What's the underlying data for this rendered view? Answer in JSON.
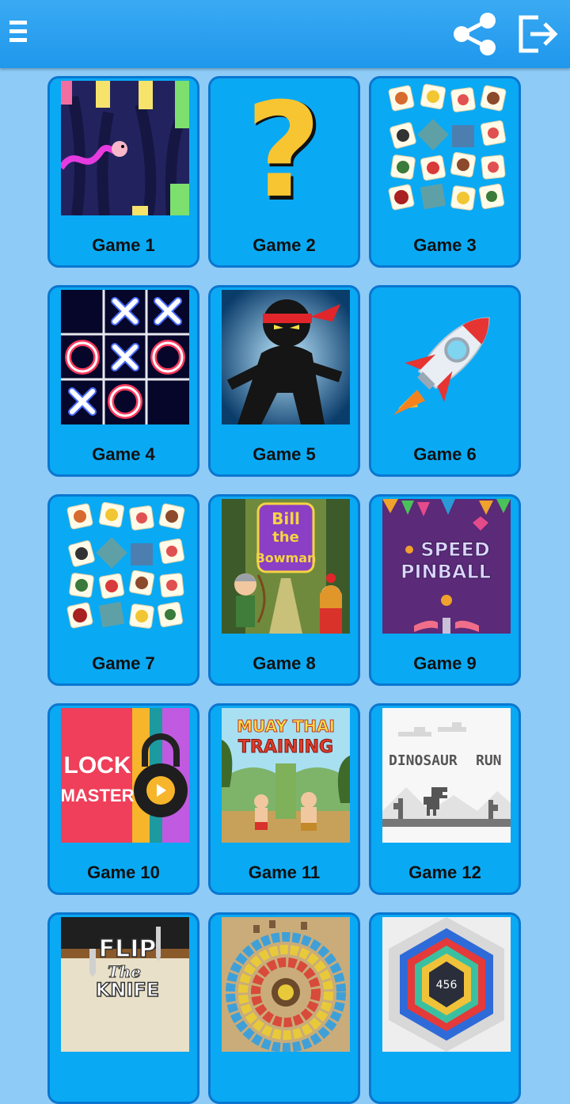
{
  "appbar": {
    "menu_icon": "hamburger-menu-icon",
    "share_icon": "share-icon",
    "exit_icon": "exit-icon",
    "bg_color": "#1f97ec"
  },
  "games": [
    {
      "label": "Game 1",
      "thumb": "flappy-bird"
    },
    {
      "label": "Game 2",
      "thumb": "question-mark"
    },
    {
      "label": "Game 3",
      "thumb": "animal-tiles"
    },
    {
      "label": "Game 4",
      "thumb": "tic-tac-toe"
    },
    {
      "label": "Game 5",
      "thumb": "ninja"
    },
    {
      "label": "Game 6",
      "thumb": "rocket"
    },
    {
      "label": "Game 7",
      "thumb": "animal-tiles"
    },
    {
      "label": "Game 8",
      "thumb": "bill-the-bowman",
      "text": [
        "Bill",
        "the",
        "Bowman"
      ]
    },
    {
      "label": "Game 9",
      "thumb": "speed-pinball",
      "text": [
        "SPEED",
        "PINBALL"
      ]
    },
    {
      "label": "Game 10",
      "thumb": "lock-master",
      "text": [
        "LOCK",
        "MASTER"
      ]
    },
    {
      "label": "Game 11",
      "thumb": "muay-thai-training",
      "text": [
        "MUAY THAI",
        "TRAINING"
      ]
    },
    {
      "label": "Game 12",
      "thumb": "dinosaur-run",
      "text": [
        "DINOSAUR",
        "RUN"
      ]
    },
    {
      "label": "",
      "thumb": "flip-the-knife",
      "text": [
        "FLIP",
        "The",
        "KNIFE"
      ]
    },
    {
      "label": "",
      "thumb": "zuma-balls"
    },
    {
      "label": "",
      "thumb": "hexagon-456",
      "text": [
        "456"
      ]
    }
  ]
}
